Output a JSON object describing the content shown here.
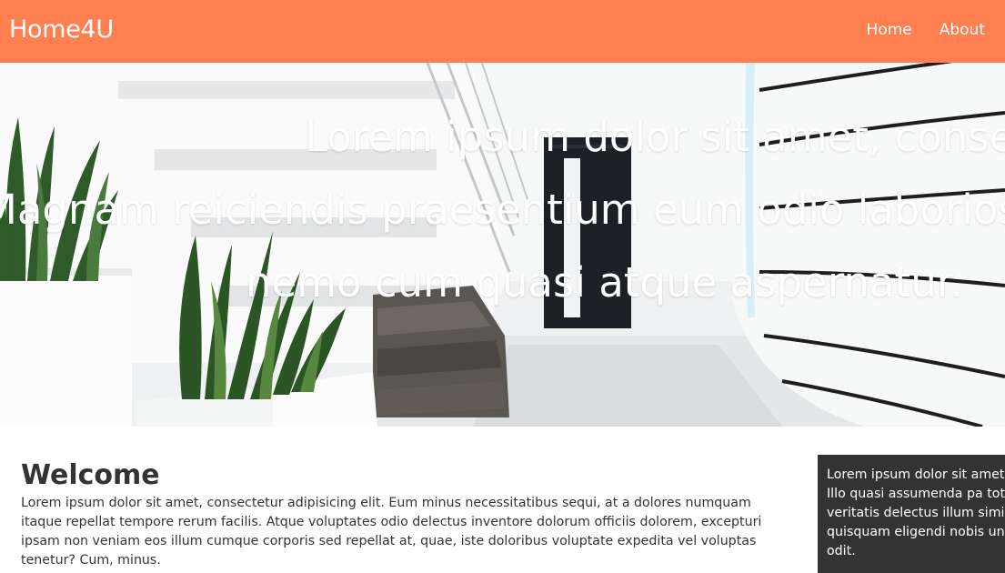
{
  "header": {
    "brand": "Home4U",
    "nav": [
      {
        "label": "Home"
      },
      {
        "label": "About"
      }
    ]
  },
  "hero": {
    "lines": [
      "Lorem ipsum dolor sit amet, consectetur adipisicing elit.",
      "Magnam reiciendis praesentium eum odio laboriosam,",
      "nemo cum quasi atque aspernatur."
    ]
  },
  "main": {
    "title": "Welcome",
    "text": "Lorem ipsum dolor sit amet, consectetur adipisicing elit. Eum minus necessitatibus sequi, at a dolores numquam itaque repellat tempore rerum facilis. Atque voluptates odio delectus inventore dolorum officiis dolorem, excepturi ipsam non veniam eos illum cumque corporis sed repellat at, quae, iste doloribus voluptate expedita vel voluptas tenetur? Cum, minus."
  },
  "aside": {
    "text": "Lorem ipsum dolor sit amet elit. Illo quasi assumenda pa totam veritatis delectus illum similique quisquam eligendi nobis unde vel odit."
  },
  "colors": {
    "navbar": "#ff7f50",
    "aside": "#333333"
  }
}
